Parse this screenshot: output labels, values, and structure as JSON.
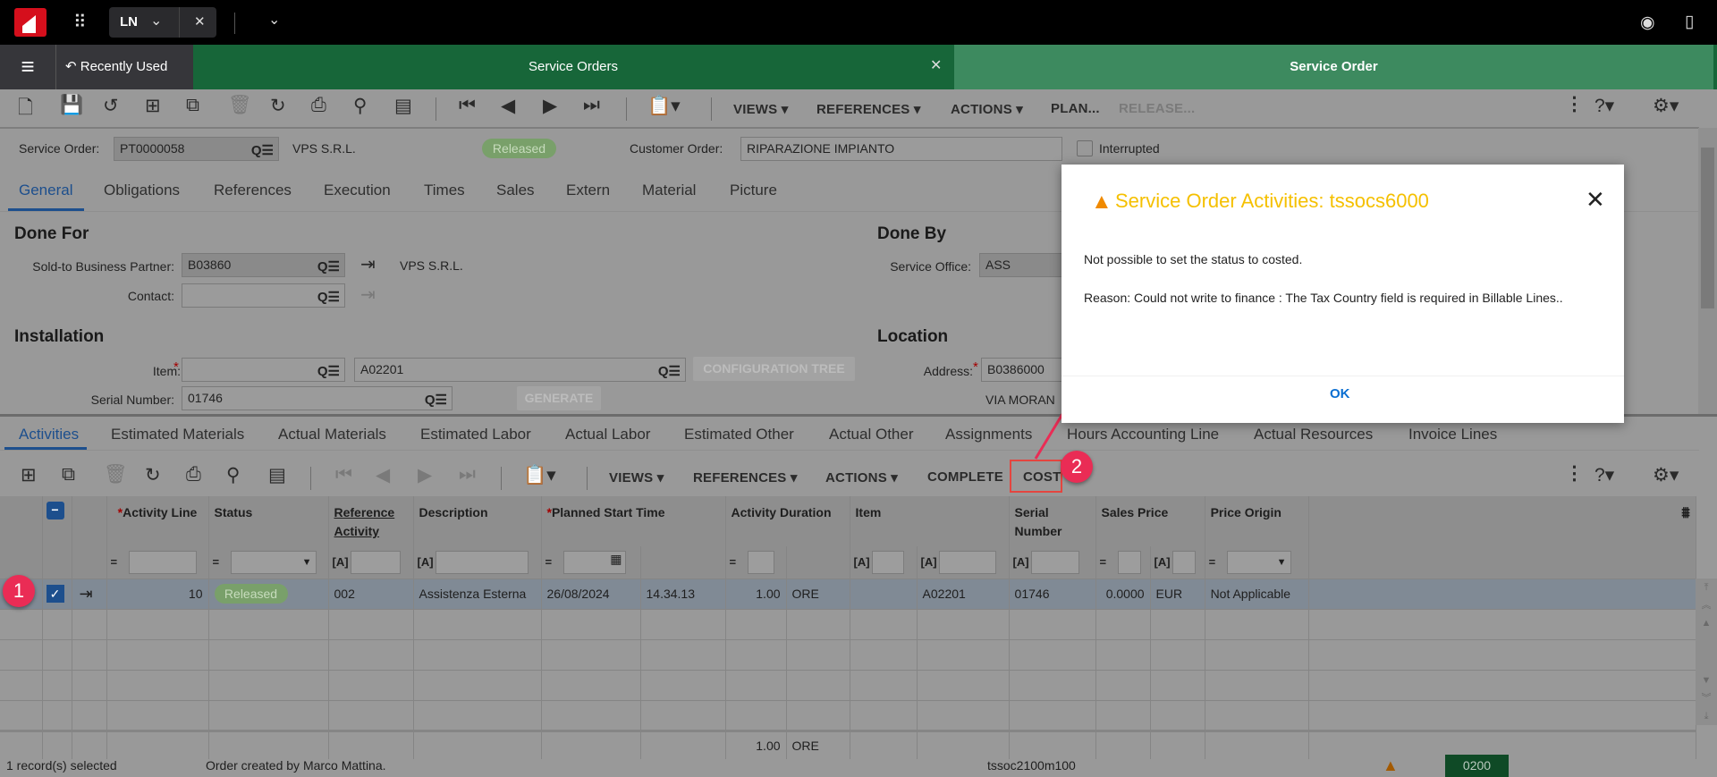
{
  "topbar": {
    "app": "LN"
  },
  "nav": {
    "recently_used": "Recently Used",
    "tab1": "Service Orders",
    "tab2": "Service Order"
  },
  "toolbar": {
    "views": "VIEWS",
    "references": "REFERENCES",
    "actions": "ACTIONS",
    "plan": "PLAN...",
    "release": "RELEASE..."
  },
  "header": {
    "so_label": "Service Order:",
    "so_value": "PT0000058",
    "so_name": "VPS S.R.L.",
    "status": "Released",
    "co_label": "Customer Order:",
    "co_value": "RIPARAZIONE IMPIANTO",
    "interrupted": "Interrupted"
  },
  "tabs": [
    "General",
    "Obligations",
    "References",
    "Execution",
    "Times",
    "Sales",
    "Extern",
    "Material",
    "Picture"
  ],
  "form": {
    "done_for": "Done For",
    "sold_to_label": "Sold-to Business Partner:",
    "sold_to_value": "B03860",
    "sold_to_name": "VPS S.R.L.",
    "contact_label": "Contact:",
    "done_by": "Done By",
    "service_office_label": "Service Office:",
    "service_office_value": "ASS",
    "installation": "Installation",
    "item_label": "Item:",
    "item_value": "A02201",
    "config_tree": "CONFIGURATION TREE",
    "serial_label": "Serial Number:",
    "serial_value": "01746",
    "generate": "GENERATE",
    "location": "Location",
    "address_label": "Address:",
    "address_value": "B0386000",
    "address_line": "VIA  MORAN"
  },
  "subtabs": [
    "Activities",
    "Estimated Materials",
    "Actual Materials",
    "Estimated Labor",
    "Actual Labor",
    "Estimated Other",
    "Actual Other",
    "Assignments",
    "Hours Accounting Line",
    "Actual Resources",
    "Invoice Lines"
  ],
  "toolbar2": {
    "views": "VIEWS",
    "references": "REFERENCES",
    "actions": "ACTIONS",
    "complete": "COMPLETE",
    "cost": "COST"
  },
  "grid": {
    "headers": {
      "activity_line": "Activity Line",
      "status": "Status",
      "reference_activity": "Reference Activity",
      "description": "Description",
      "planned_start": "Planned Start Time",
      "duration": "Activity Duration",
      "item": "Item",
      "serial": "Serial Number",
      "sales_price": "Sales Price",
      "price_origin": "Price Origin"
    },
    "op_eq": "=",
    "op_a": "[A]",
    "row": {
      "line": "10",
      "status": "Released",
      "ref": "002",
      "description": "Assistenza Esterna",
      "date": "26/08/2024",
      "time": "14.34.13",
      "duration": "1.00",
      "unit": "ORE",
      "item": "A02201",
      "serial": "01746",
      "price": "0.0000",
      "currency": "EUR",
      "origin": "Not Applicable"
    },
    "totals": {
      "duration": "1.00",
      "unit": "ORE"
    }
  },
  "statusbar": {
    "selected": "1 record(s) selected",
    "message": "Order created by Marco Mattina.",
    "session": "tssoc2100m100",
    "code": "0200"
  },
  "dialog": {
    "title": "Service Order Activities: tssocs6000",
    "line1": "Not possible to set the status to costed.",
    "line2": "Reason: Could not write to finance : The Tax Country field is required in Billable Lines..",
    "ok": "OK"
  },
  "annotations": {
    "m1": "1",
    "m2": "2"
  },
  "colors": {
    "nav": "#176639",
    "active_tab": "#3d8a5f",
    "title": "#f5c000",
    "accent": "#1d4f8d",
    "marker": "#ea2c55"
  }
}
